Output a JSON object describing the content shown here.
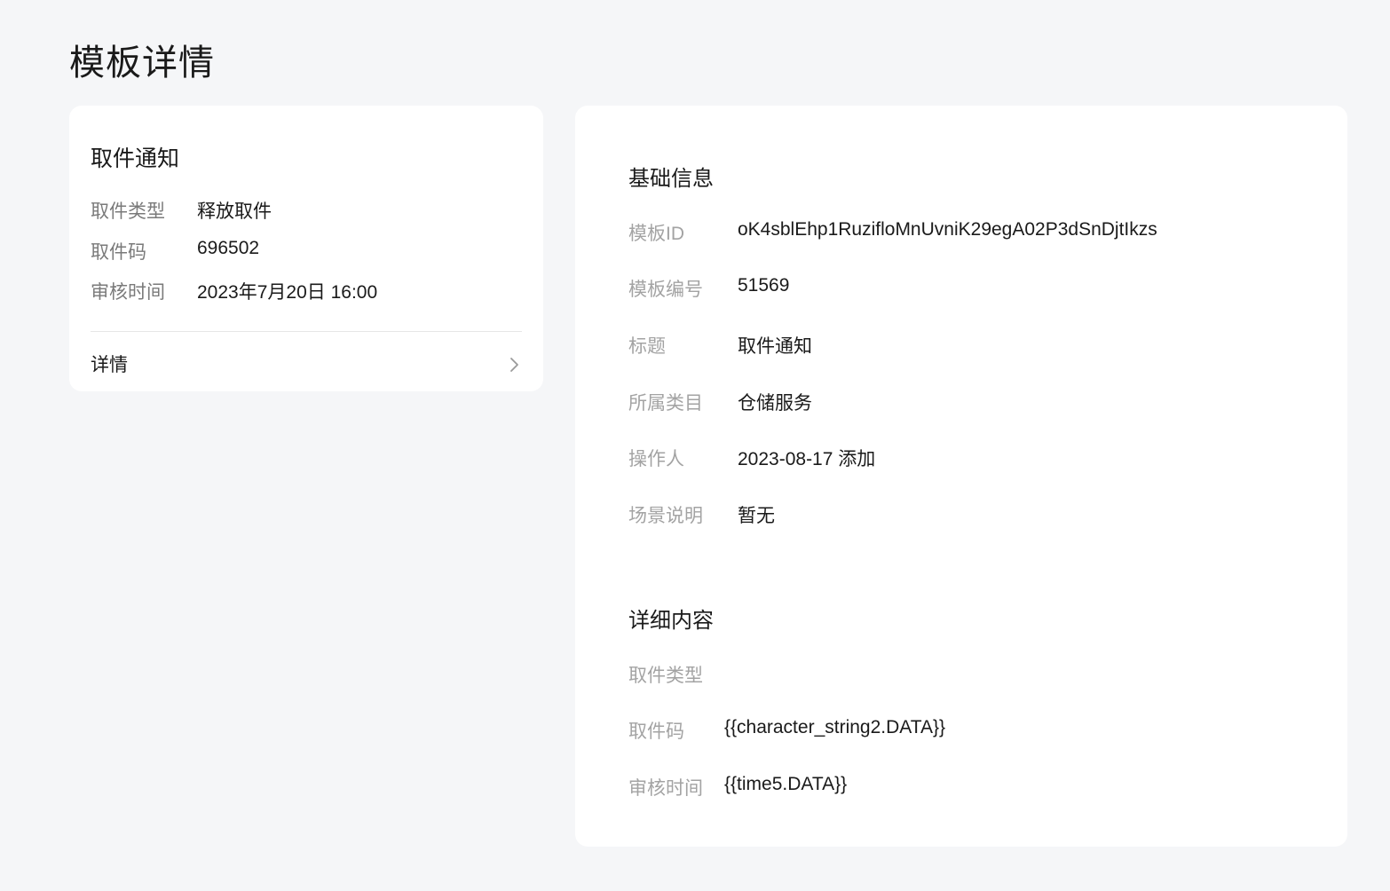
{
  "page": {
    "title": "模板详情"
  },
  "preview": {
    "title": "取件通知",
    "rows": [
      {
        "label": "取件类型",
        "value": "释放取件"
      },
      {
        "label": "取件码",
        "value": "696502"
      },
      {
        "label": "审核时间",
        "value": "2023年7月20日 16:00"
      }
    ],
    "more_label": "详情",
    "more_icon": "chevron-right-icon"
  },
  "basic": {
    "title": "基础信息",
    "rows": [
      {
        "label": "模板ID",
        "value": "oK4sblEhp1RuzifloMnUvniK29egA02P3dSnDjtIkzs"
      },
      {
        "label": "模板编号",
        "value": "51569"
      },
      {
        "label": "标题",
        "value": "取件通知"
      },
      {
        "label": "所属类目",
        "value": "仓储服务"
      },
      {
        "label": "操作人",
        "value": "2023-08-17 添加"
      },
      {
        "label": "场景说明",
        "value": "暂无"
      }
    ]
  },
  "content": {
    "title": "详细内容",
    "rows": [
      {
        "label": "取件类型",
        "value": ""
      },
      {
        "label": "取件码",
        "value": "{{character_string2.DATA}}"
      },
      {
        "label": "审核时间",
        "value": "{{time5.DATA}}"
      }
    ]
  }
}
